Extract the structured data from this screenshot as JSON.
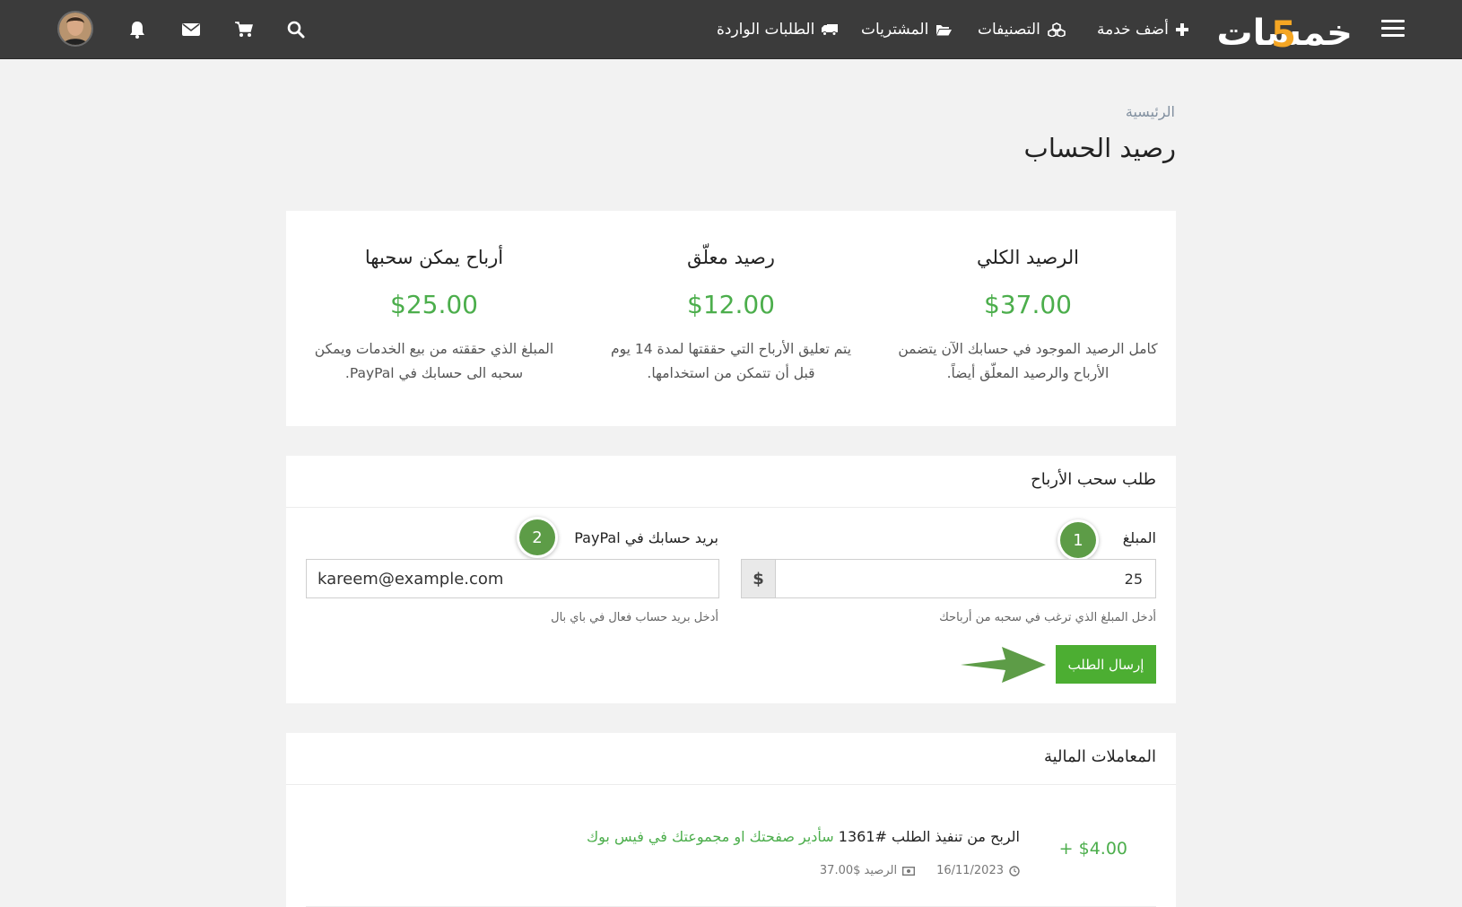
{
  "nav": {
    "logo_text": "خمسات",
    "items": [
      {
        "label": "أضف خدمة",
        "icon": "plus-icon"
      },
      {
        "label": "التصنيفات",
        "icon": "cubes-icon"
      },
      {
        "label": "المشتريات",
        "icon": "folder-open-icon"
      },
      {
        "label": "الطلبات الواردة",
        "icon": "truck-icon"
      }
    ],
    "icons": [
      "search-icon",
      "cart-icon",
      "envelope-icon",
      "bell-icon",
      "user-avatar",
      "hamburger-icon"
    ]
  },
  "page": {
    "breadcrumb": "الرئيسية",
    "title": "رصيد الحساب"
  },
  "balances": [
    {
      "title": "الرصيد الكلي",
      "value": "$37.00",
      "description": "كامل الرصيد الموجود في حسابك الآن يتضمن الأرباح والرصيد المعلّق أيضاً."
    },
    {
      "title": "رصيد معلّق",
      "value": "$12.00",
      "description": "يتم تعليق الأرباح التي حققتها لمدة 14 يوم قبل أن تتمكن من استخدامها."
    },
    {
      "title": "أرباح يمكن سحبها",
      "value": "$25.00",
      "description": "المبلغ الذي حققته من بيع الخدمات ويمكن سحبه الى حسابك في PayPal."
    }
  ],
  "withdraw": {
    "header": "طلب سحب الأرباح",
    "amount_label": "المبلغ",
    "amount_value": "25",
    "currency_addon": "$",
    "amount_help": "أدخل المبلغ الذي ترغب في سحبه من أرباحك",
    "email_label": "بريد حسابك في PayPal",
    "email_value": "kareem@example.com",
    "email_help": "أدخل بريد حساب فعال في باي بال",
    "submit_label": "إرسال الطلب",
    "step_badges": [
      "1",
      "2"
    ]
  },
  "transactions": {
    "header": "المعاملات المالية",
    "items": [
      {
        "amount": "+ $4.00",
        "title_prefix": "الربح من تنفيذ الطلب #1361",
        "service_link": "سأدير صفحتك او مجموعتك في فيس بوك",
        "date": "16/11/2023",
        "balance": "الرصيد $37.00"
      }
    ]
  },
  "colors": {
    "navbar": "#3b3b3b",
    "accent_green": "#4cae4c",
    "logo_accent": "#f5a623",
    "badge_green": "#5d9c47"
  }
}
